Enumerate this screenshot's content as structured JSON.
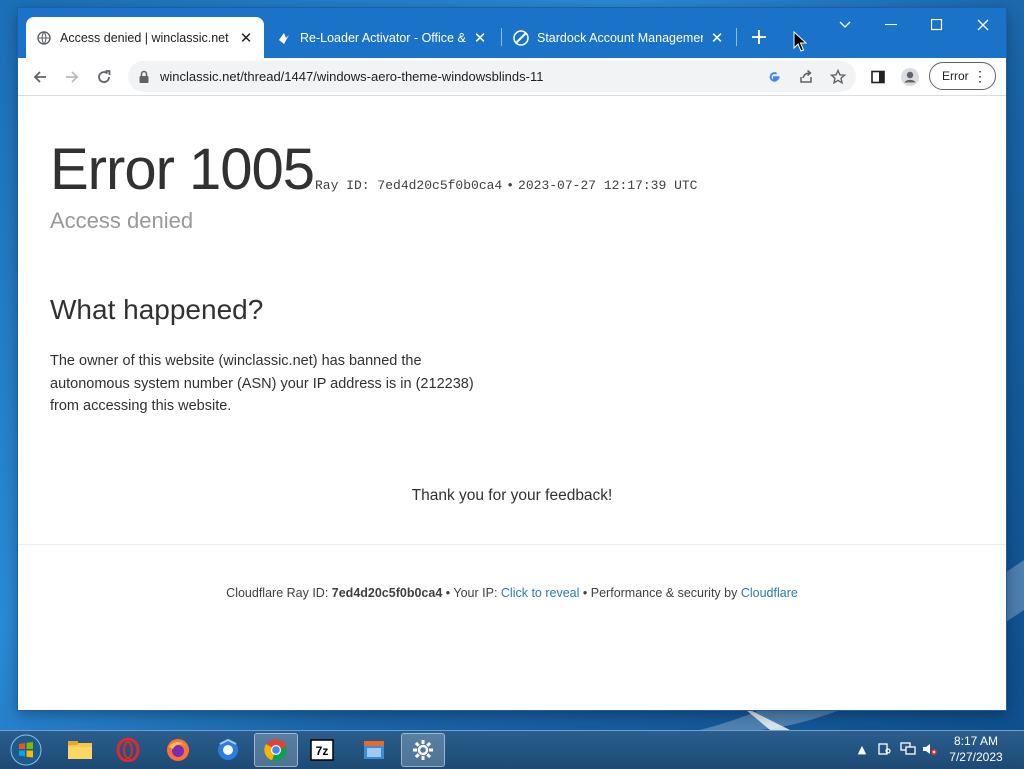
{
  "browser": {
    "tabs": [
      {
        "title": "Access denied | winclassic.net us",
        "favicon": "globe-icon",
        "active": true
      },
      {
        "title": "Re-Loader Activator - Office & W",
        "favicon": "reloader-icon",
        "active": false
      },
      {
        "title": "Stardock Account Management",
        "favicon": "stardock-icon",
        "active": false
      }
    ],
    "new_tab_label": "+",
    "url": "winclassic.net/thread/1447/windows-aero-theme-windowsblinds-11",
    "profile_chip": "Error",
    "window_controls": [
      "minimize-icon",
      "maximize-icon",
      "close-icon"
    ]
  },
  "page": {
    "error_code": "Error 1005",
    "ray_id_label": "Ray ID: 7ed4d20c5f0b0ca4",
    "bullet": "•",
    "timestamp": "2023-07-27 12:17:39 UTC",
    "subtitle": "Access denied",
    "heading": "What happened?",
    "explanation": "The owner of this website (winclassic.net) has banned the autonomous system number (ASN) your IP address is in (212238) from accessing this website.",
    "thanks": "Thank you for your feedback!",
    "footer": {
      "ray_prefix": "Cloudflare Ray ID:",
      "ray_id": "7ed4d20c5f0b0ca4",
      "sep": "•",
      "ip_prefix": "Your IP:",
      "ip_link": "Click to reveal",
      "perf_prefix": "Performance & security by",
      "cf_link": "Cloudflare"
    }
  },
  "taskbar": {
    "apps": [
      "file-explorer-icon",
      "opera-icon",
      "firefox-icon",
      "browser-icon",
      "chrome-icon",
      "7zip-icon",
      "windowblinds-icon",
      "settings-icon"
    ],
    "clock_time": "8:17 AM",
    "clock_date": "7/27/2023"
  },
  "colors": {
    "titlebar": "#1a73c9",
    "link": "#2c7cb0",
    "desktop": "#1b6fb6"
  }
}
